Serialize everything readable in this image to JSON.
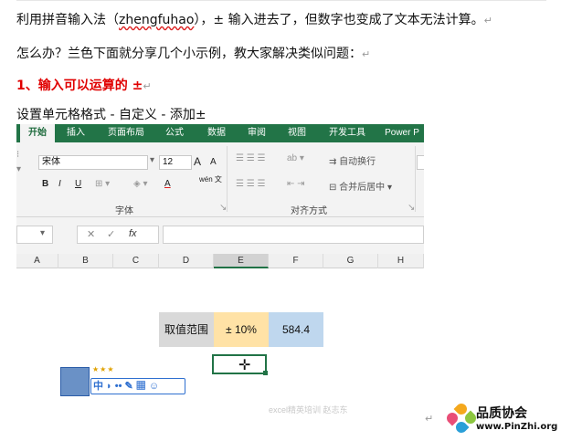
{
  "article": {
    "line1_pre": "利用拼音输入法（",
    "line1_word": "zhengfuhao",
    "line1_post": "），± 输入进去了，但数字也变成了文本无法计算。",
    "line2": "怎么办？兰色下面就分享几个小示例，教大家解决类似问题：",
    "heading": "1、输入可以运算的 ±",
    "line4": "设置单元格格式 - 自定义 - 添加±",
    "return_mark": "↵"
  },
  "excel": {
    "tabs": [
      "开始",
      "插入",
      "页面布局",
      "公式",
      "数据",
      "审阅",
      "视图",
      "开发工具",
      "Power P"
    ],
    "active_tab": "开始",
    "ribbon": {
      "font_name": "宋体",
      "font_size": "12",
      "grow_font": "A",
      "shrink_font": "A",
      "bold": "B",
      "italic": "I",
      "underline": "U",
      "font_color": "A",
      "wen": "wén\n文",
      "wrap_text": "自动换行",
      "merge_center": "合并后居中",
      "group_font": "字体",
      "group_alignment": "对齐方式"
    },
    "formula_bar": {
      "cancel": "✕",
      "confirm": "✓",
      "fx": "fx"
    },
    "columns": [
      "A",
      "B",
      "C",
      "D",
      "E",
      "F",
      "G",
      "H"
    ],
    "selected_column": "E",
    "cells": {
      "label": "取值范围",
      "pct": "± 10%",
      "value": "584.4"
    },
    "ime": {
      "stars": "★★★",
      "bar": "中 ◗ •• ✎ ▦ ☺"
    },
    "watermark": "excel精英培训  赵志东"
  },
  "logo": {
    "title": "品质协会",
    "url": "www.PinZhi.org",
    "colors": [
      "#f4a81d",
      "#8cc63f",
      "#2a9fd8",
      "#e94e77",
      "#f26b21"
    ]
  },
  "colors": {
    "excel_green": "#227447",
    "heading_red": "#e00000",
    "cell_gray": "#d9d9d9",
    "cell_orange": "#ffe2a6",
    "cell_blue": "#bfd7ee"
  }
}
